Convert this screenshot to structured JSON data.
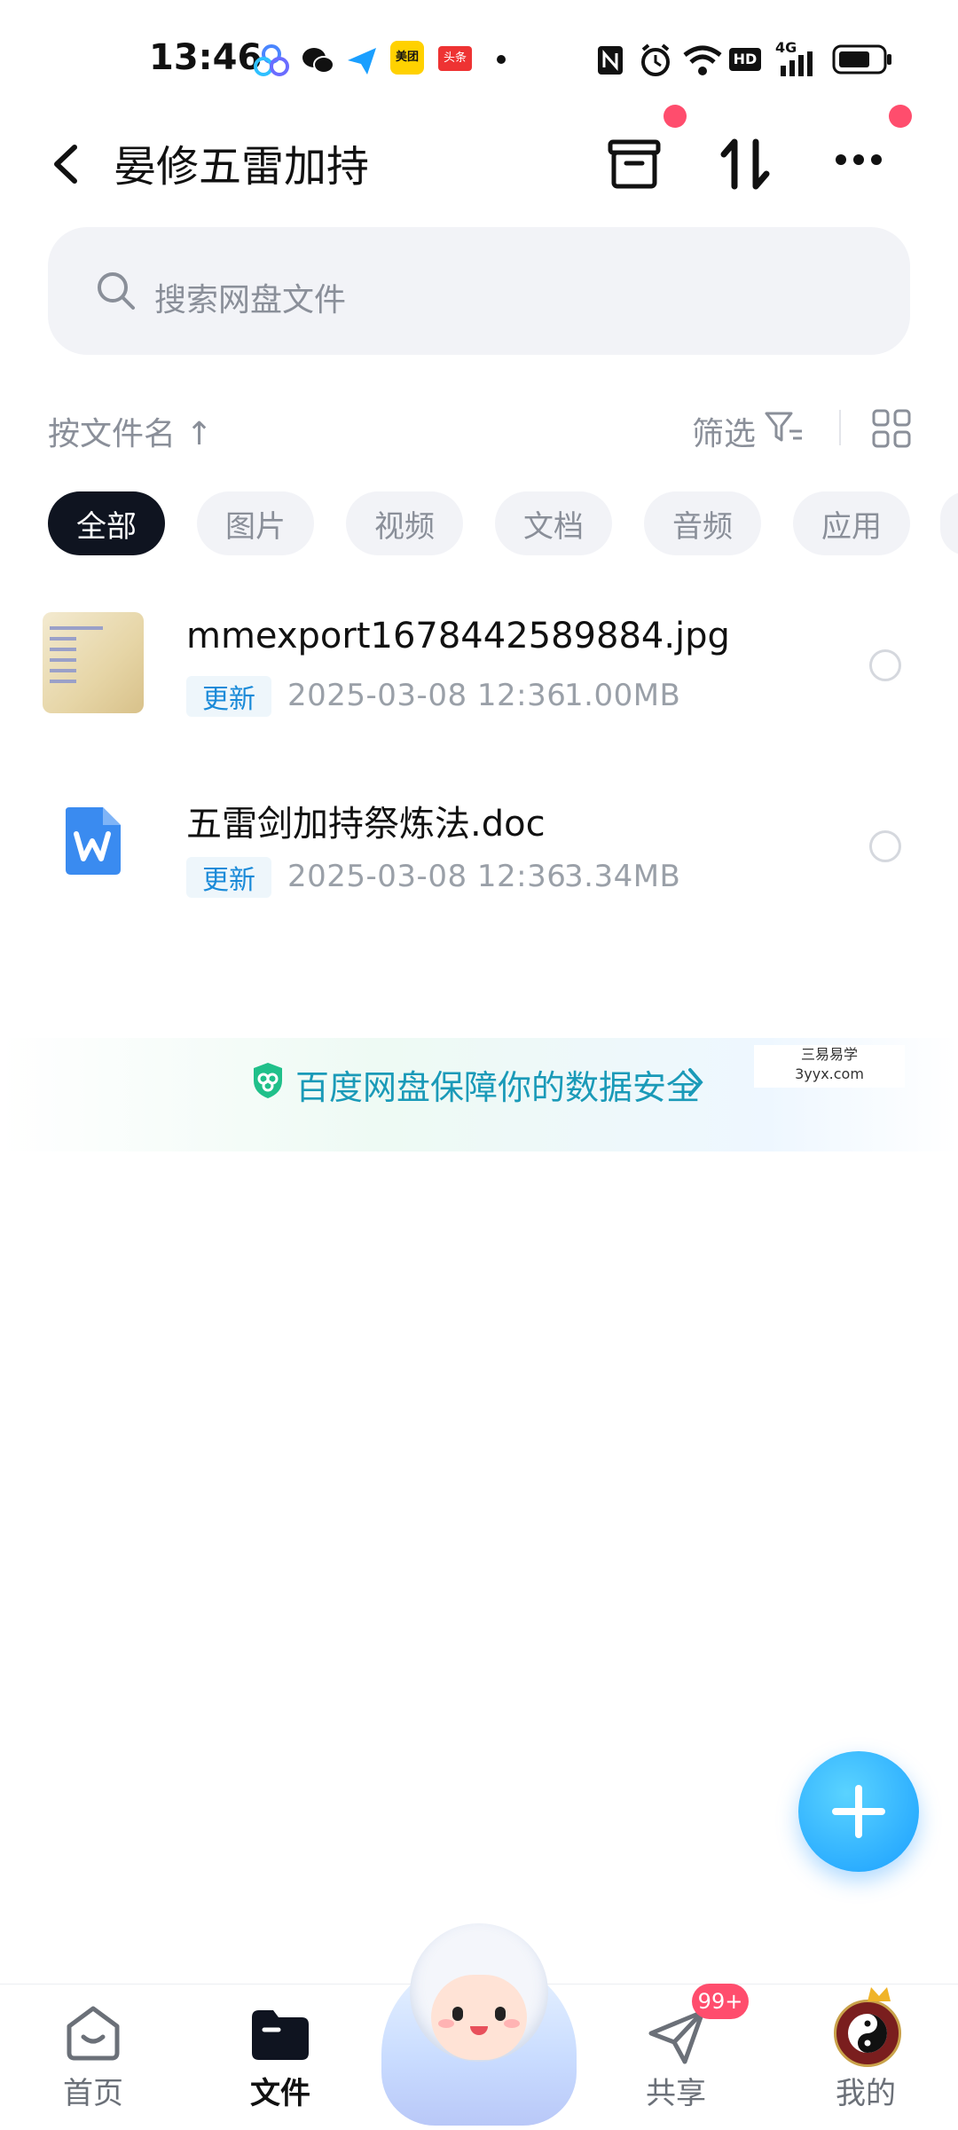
{
  "status_bar": {
    "time": "13:46",
    "meituan_label": "美团",
    "toutiao_label": "头条",
    "network": "4G",
    "hd": "HD"
  },
  "header": {
    "title": "晏修五雷加持"
  },
  "search": {
    "placeholder": "搜索网盘文件"
  },
  "sort_bar": {
    "sort_label": "按文件名 ↑",
    "filter_label": "筛选"
  },
  "chips": [
    {
      "label": "全部",
      "active": true
    },
    {
      "label": "图片",
      "active": false
    },
    {
      "label": "视频",
      "active": false
    },
    {
      "label": "文档",
      "active": false
    },
    {
      "label": "音频",
      "active": false
    },
    {
      "label": "应用",
      "active": false
    }
  ],
  "files": [
    {
      "name": "mmexport1678442589884.jpg",
      "badge": "更新",
      "date": "2025-03-08  12:36",
      "size": "1.00MB",
      "icon": "image-thumbnail"
    },
    {
      "name": "五雷剑加持祭炼法.doc",
      "badge": "更新",
      "date": "2025-03-08  12:36",
      "size": "3.34MB",
      "icon": "word-doc-icon"
    }
  ],
  "banner": {
    "text": "百度网盘保障你的数据安全",
    "watermark_line1": "三易易学",
    "watermark_line2": "3yyx.com"
  },
  "bottom_nav": {
    "home": "首页",
    "files": "文件",
    "share": "共享",
    "share_badge": "99+",
    "mine": "我的"
  },
  "colors": {
    "accent": "#1a9fff",
    "active_chip": "#0f1420",
    "notification_red": "#ff4d6d",
    "update_badge": "#1a8ad8"
  }
}
